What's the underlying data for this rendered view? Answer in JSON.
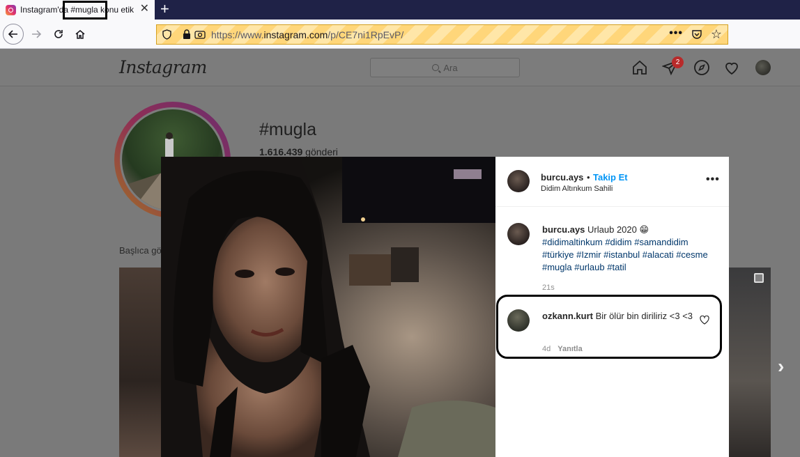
{
  "browser": {
    "tab_title": "Instagram'da #mugla konu etik",
    "url_prefix": "https://www.",
    "url_domain": "instagram.com",
    "url_path": "/p/CE7ni1RpEvP/"
  },
  "instagram": {
    "logo": "Instagram",
    "search_placeholder": "Ara",
    "direct_badge": "2",
    "profile": {
      "hashtag": "#mugla",
      "post_count": "1.616.439",
      "post_label": " gönderi"
    },
    "section_label": "Başlıca gö"
  },
  "modal": {
    "header": {
      "username": "burcu.ays",
      "separator": "•",
      "follow_label": "Takip Et",
      "location": "Didim Altınkum Sahili"
    },
    "caption": {
      "username": "burcu.ays",
      "text": " Urlaub 2020 😁",
      "hashtags": "#didimaltinkum #didim #samandidim #türkiye #Izmir #istanbul #alacati #cesme #mugla #urlaub #tatil",
      "time": "21s"
    },
    "comment": {
      "username": "ozkann.kurt",
      "text": " Bir ölür bin diriliriz <3 <3",
      "time": "4d",
      "reply_label": "Yanıtla"
    }
  },
  "colors": {
    "accent_link": "#0095f6",
    "hashtag": "#00376b",
    "browser_tabbar": "#1f2247",
    "badge": "#b82a2a"
  }
}
